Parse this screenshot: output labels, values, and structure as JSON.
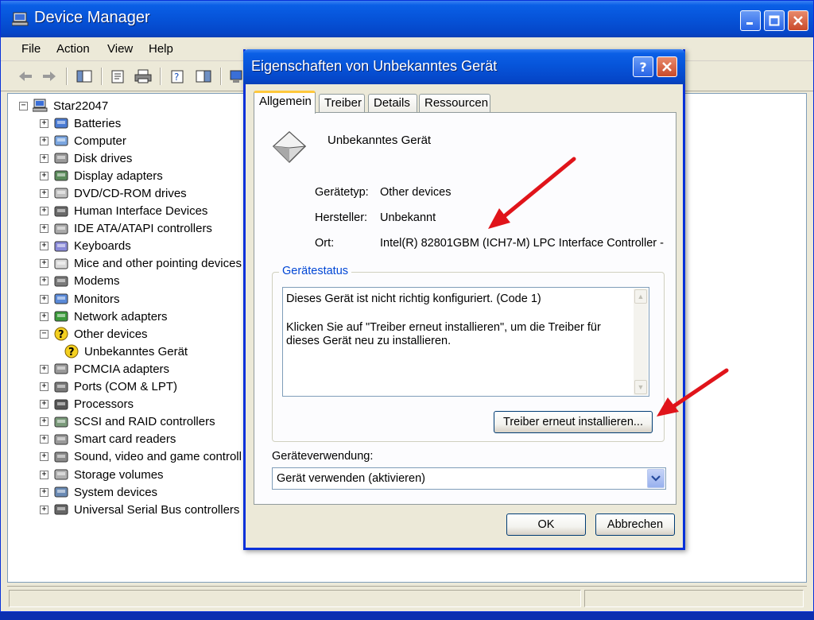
{
  "main_window": {
    "title": "Device Manager",
    "menu": [
      "File",
      "Action",
      "View",
      "Help"
    ],
    "tree": {
      "root": "Star22047",
      "items": [
        {
          "label": "Batteries",
          "icon": "battery-icon",
          "expander": "+"
        },
        {
          "label": "Computer",
          "icon": "computer-icon",
          "expander": "+"
        },
        {
          "label": "Disk drives",
          "icon": "disk-drive-icon",
          "expander": "+"
        },
        {
          "label": "Display adapters",
          "icon": "display-adapter-icon",
          "expander": "+"
        },
        {
          "label": "DVD/CD-ROM drives",
          "icon": "cd-rom-icon",
          "expander": "+"
        },
        {
          "label": "Human Interface Devices",
          "icon": "hid-icon",
          "expander": "+"
        },
        {
          "label": "IDE ATA/ATAPI controllers",
          "icon": "ide-controller-icon",
          "expander": "+"
        },
        {
          "label": "Keyboards",
          "icon": "keyboard-icon",
          "expander": "+"
        },
        {
          "label": "Mice and other pointing devices",
          "icon": "mouse-icon",
          "expander": "+"
        },
        {
          "label": "Modems",
          "icon": "modem-icon",
          "expander": "+"
        },
        {
          "label": "Monitors",
          "icon": "monitor-icon",
          "expander": "+"
        },
        {
          "label": "Network adapters",
          "icon": "network-adapter-icon",
          "expander": "+"
        },
        {
          "label": "Other devices",
          "icon": "other-devices-icon",
          "expander": "-"
        },
        {
          "label": "Unbekanntes Gerät",
          "icon": "unknown-device-icon",
          "expander": ""
        },
        {
          "label": "PCMCIA adapters",
          "icon": "pcmcia-icon",
          "expander": "+"
        },
        {
          "label": "Ports (COM & LPT)",
          "icon": "port-icon",
          "expander": "+"
        },
        {
          "label": "Processors",
          "icon": "processor-icon",
          "expander": "+"
        },
        {
          "label": "SCSI and RAID controllers",
          "icon": "scsi-icon",
          "expander": "+"
        },
        {
          "label": "Smart card readers",
          "icon": "smart-card-icon",
          "expander": "+"
        },
        {
          "label": "Sound, video and game controll",
          "icon": "sound-icon",
          "expander": "+"
        },
        {
          "label": "Storage volumes",
          "icon": "storage-volume-icon",
          "expander": "+"
        },
        {
          "label": "System devices",
          "icon": "system-device-icon",
          "expander": "+"
        },
        {
          "label": "Universal Serial Bus controllers",
          "icon": "usb-icon",
          "expander": "+"
        }
      ]
    }
  },
  "dialog": {
    "title": "Eigenschaften von Unbekanntes Gerät",
    "tabs": [
      "Allgemein",
      "Treiber",
      "Details",
      "Ressourcen"
    ],
    "active_tab": "Allgemein",
    "device_name": "Unbekanntes Gerät",
    "properties": [
      {
        "label": "Gerätetyp:",
        "value": "Other devices"
      },
      {
        "label": "Hersteller:",
        "value": "Unbekannt"
      },
      {
        "label": "Ort:",
        "value": "Intel(R) 82801GBM (ICH7-M) LPC Interface Controller -"
      }
    ],
    "status_group_label": "Gerätestatus",
    "status_line1": "Dieses Gerät ist nicht richtig konfiguriert. (Code 1)",
    "status_line2": "Klicken Sie auf \"Treiber erneut installieren\", um die Treiber für dieses Gerät neu zu installieren.",
    "reinstall_button": "Treiber erneut installieren...",
    "usage_label": "Geräteverwendung:",
    "usage_value": "Gerät verwenden (aktivieren)",
    "ok_button": "OK",
    "cancel_button": "Abbrechen"
  },
  "colors": {
    "title_blue": "#0653d8",
    "annotation_arrow": "#e0141a",
    "group_label": "#0046d5"
  }
}
